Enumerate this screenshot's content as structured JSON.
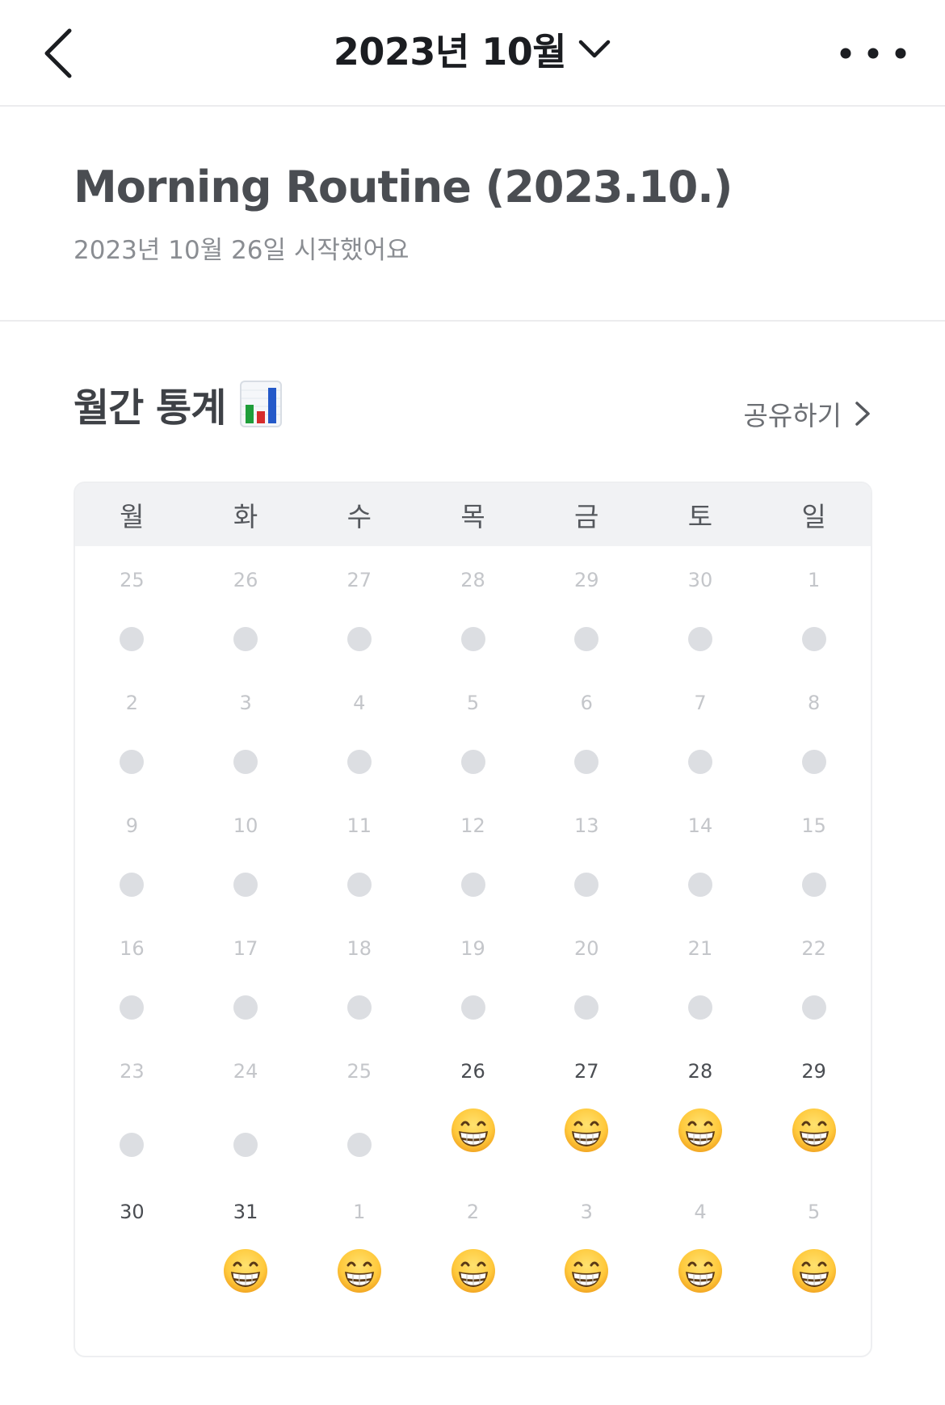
{
  "nav": {
    "title": "2023년 10월"
  },
  "header": {
    "title": "Morning Routine (2023.10.)",
    "subtitle": "2023년 10월 26일 시작했어요"
  },
  "stats": {
    "title": "월간 통계",
    "share_label": "공유하기"
  },
  "calendar": {
    "weekdays": [
      "월",
      "화",
      "수",
      "목",
      "금",
      "토",
      "일"
    ],
    "weeks": [
      [
        {
          "day": "25",
          "status": "empty"
        },
        {
          "day": "26",
          "status": "empty"
        },
        {
          "day": "27",
          "status": "empty"
        },
        {
          "day": "28",
          "status": "empty"
        },
        {
          "day": "29",
          "status": "empty"
        },
        {
          "day": "30",
          "status": "empty"
        },
        {
          "day": "1",
          "status": "empty"
        }
      ],
      [
        {
          "day": "2",
          "status": "empty"
        },
        {
          "day": "3",
          "status": "empty"
        },
        {
          "day": "4",
          "status": "empty"
        },
        {
          "day": "5",
          "status": "empty"
        },
        {
          "day": "6",
          "status": "empty"
        },
        {
          "day": "7",
          "status": "empty"
        },
        {
          "day": "8",
          "status": "empty"
        }
      ],
      [
        {
          "day": "9",
          "status": "empty"
        },
        {
          "day": "10",
          "status": "empty"
        },
        {
          "day": "11",
          "status": "empty"
        },
        {
          "day": "12",
          "status": "empty"
        },
        {
          "day": "13",
          "status": "empty"
        },
        {
          "day": "14",
          "status": "empty"
        },
        {
          "day": "15",
          "status": "empty"
        }
      ],
      [
        {
          "day": "16",
          "status": "empty"
        },
        {
          "day": "17",
          "status": "empty"
        },
        {
          "day": "18",
          "status": "empty"
        },
        {
          "day": "19",
          "status": "empty"
        },
        {
          "day": "20",
          "status": "empty"
        },
        {
          "day": "21",
          "status": "empty"
        },
        {
          "day": "22",
          "status": "empty"
        }
      ],
      [
        {
          "day": "23",
          "status": "empty"
        },
        {
          "day": "24",
          "status": "empty"
        },
        {
          "day": "25",
          "status": "empty"
        },
        {
          "day": "26",
          "status": "done",
          "active": true
        },
        {
          "day": "27",
          "status": "done",
          "active": true
        },
        {
          "day": "28",
          "status": "done",
          "active": true
        },
        {
          "day": "29",
          "status": "done",
          "active": true
        }
      ],
      [
        {
          "day": "30",
          "status": "none",
          "active": true
        },
        {
          "day": "31",
          "status": "done",
          "active": true
        },
        {
          "day": "1",
          "status": "done"
        },
        {
          "day": "2",
          "status": "done"
        },
        {
          "day": "3",
          "status": "done"
        },
        {
          "day": "4",
          "status": "done"
        },
        {
          "day": "5",
          "status": "done"
        }
      ]
    ],
    "done_icon": "grinning-face-icon",
    "empty_icon": "gray-dot-icon"
  },
  "colors": {
    "dot": "#dcdee2",
    "header_bg": "#f1f2f4",
    "day_inactive": "#c4c6ca",
    "day_active": "#4a4d52"
  }
}
